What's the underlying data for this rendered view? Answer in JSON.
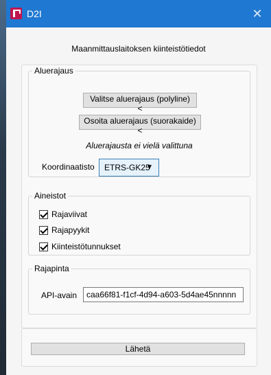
{
  "window": {
    "title": "D2I",
    "close_glyph": "✕",
    "icon": "d2i-app-icon",
    "title_bar_color": "#1f78d1"
  },
  "heading": "Maanmittauslaitoksen kiinteistötiedot",
  "area_group": {
    "legend": "Aluerajaus",
    "polyline_button": "Valitse aluerajaus (polyline) <",
    "rect_button": "Osoita aluerajaus (suorakaide) <",
    "status": "Aluerajausta ei vielä valittuna",
    "coord_label": "Koordinaatisto",
    "coord_value": "ETRS-GK25"
  },
  "materials_group": {
    "legend": "Aineistot",
    "items": [
      {
        "label": "Rajaviivat",
        "checked": true
      },
      {
        "label": "Rajapyykit",
        "checked": true
      },
      {
        "label": "Kiinteistötunnukset",
        "checked": true
      }
    ]
  },
  "api_group": {
    "legend": "Rajapinta",
    "key_label": "API-avain",
    "key_value": "caa66f81-f1cf-4d94-a603-5d4ae45nnnnn"
  },
  "submit_button": "Lähetä"
}
